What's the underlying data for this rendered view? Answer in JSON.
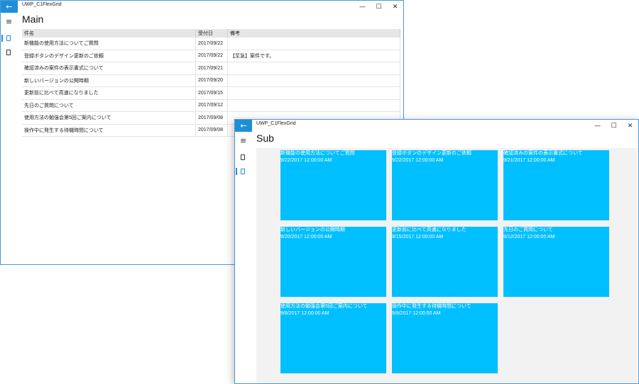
{
  "main_window": {
    "app_title": "UWP_C1FlexGrid",
    "page_title": "Main",
    "back_label": "←",
    "caption": {
      "minimize": "—",
      "maximize": "☐",
      "close": "✕"
    },
    "menu_glyph": "≡",
    "columns": [
      "件名",
      "受付日",
      "備考"
    ],
    "rows": [
      {
        "subject": "新機能の使用方法についてご質問",
        "date": "2017/09/22",
        "note": ""
      },
      {
        "subject": "登録ボタンのデザイン更新のご依頼",
        "date": "2017/09/22",
        "note": "【至急】案件です。"
      },
      {
        "subject": "確認済みの案件の表示書式について",
        "date": "2017/09/21",
        "note": ""
      },
      {
        "subject": "新しいバージョンの公開時期",
        "date": "2017/09/20",
        "note": ""
      },
      {
        "subject": "更新前に比べて高速になりました",
        "date": "2017/09/15",
        "note": ""
      },
      {
        "subject": "先日のご質問について",
        "date": "2017/09/12",
        "note": ""
      },
      {
        "subject": "使用方法の勉強会第5回ご案内について",
        "date": "2017/09/08",
        "note": ""
      },
      {
        "subject": "操作中に発生する待機時間について",
        "date": "2017/09/08",
        "note": ""
      }
    ]
  },
  "sub_window": {
    "app_title": "UWP_C1FlexGrid",
    "page_title": "Sub",
    "back_label": "←",
    "caption": {
      "minimize": "—",
      "maximize": "☐",
      "close": "✕"
    },
    "menu_glyph": "≡",
    "tiles": [
      {
        "subject": "新機能の使用方法についてご質問",
        "datetime": "9/22/2017 12:00:00 AM"
      },
      {
        "subject": "登録ボタンのデザイン更新のご依頼",
        "datetime": "9/22/2017 12:00:00 AM"
      },
      {
        "subject": "確認済みの案件の表示書式について",
        "datetime": "9/21/2017 12:00:00 AM"
      },
      {
        "subject": "新しいバージョンの公開時期",
        "datetime": "9/20/2017 12:00:00 AM"
      },
      {
        "subject": "更新前に比べて高速になりました",
        "datetime": "9/15/2017 12:00:00 AM"
      },
      {
        "subject": "先日のご質問について",
        "datetime": "9/12/2017 12:00:00 AM"
      },
      {
        "subject": "使用方法の勉強会第5回ご案内について",
        "datetime": "9/8/2017 12:00:00 AM"
      },
      {
        "subject": "操作中に発生する待機時間について",
        "datetime": "9/8/2017 12:00:00 AM"
      }
    ]
  },
  "colors": {
    "accent": "#1e8fd6",
    "tile": "#00bfff",
    "panel": "#f2f2f2",
    "header": "#e6e6e6"
  }
}
